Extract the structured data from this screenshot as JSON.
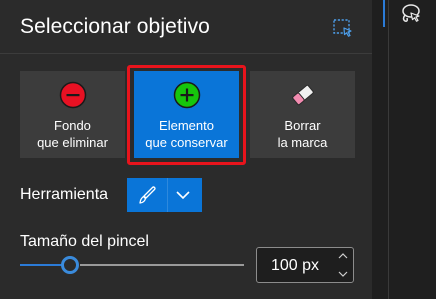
{
  "panel": {
    "title": "Seleccionar objetivo"
  },
  "modes": {
    "remove": {
      "line1": "Fondo",
      "line2": "que eliminar",
      "icon": "minus-circle-icon",
      "color": "#e81123"
    },
    "keep": {
      "line1": "Elemento",
      "line2": "que conservar",
      "icon": "plus-circle-icon",
      "color": "#16c60c",
      "selected": true
    },
    "erase": {
      "line1": "Borrar",
      "line2": "la marca",
      "icon": "eraser-icon"
    }
  },
  "tool": {
    "label": "Herramienta",
    "selected_icon": "brush-icon"
  },
  "brush_size": {
    "label": "Tamaño del pincel",
    "value": "100 px",
    "slider_fraction": 0.2
  },
  "colors": {
    "accent": "#0a75d8",
    "selection_outline": "#e8141c"
  }
}
